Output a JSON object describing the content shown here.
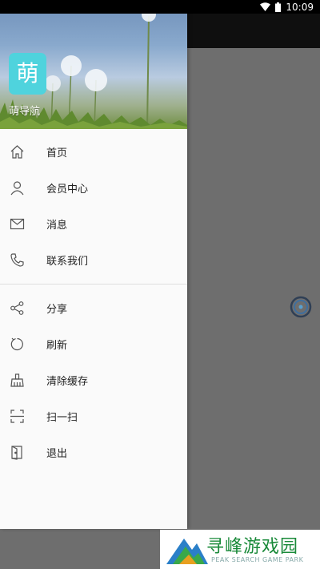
{
  "status_bar": {
    "time": "10:09"
  },
  "drawer": {
    "header": {
      "logo_char": "萌",
      "app_name": "萌导航"
    },
    "section1": [
      {
        "label": "首页",
        "icon": "home-icon"
      },
      {
        "label": "会员中心",
        "icon": "user-icon"
      },
      {
        "label": "消息",
        "icon": "mail-icon"
      },
      {
        "label": "联系我们",
        "icon": "phone-icon"
      }
    ],
    "section2": [
      {
        "label": "分享",
        "icon": "share-icon"
      },
      {
        "label": "刷新",
        "icon": "refresh-icon"
      },
      {
        "label": "清除缓存",
        "icon": "broom-icon"
      },
      {
        "label": "扫一扫",
        "icon": "scan-icon"
      },
      {
        "label": "退出",
        "icon": "exit-icon"
      }
    ]
  },
  "watermark": {
    "title": "寻峰游戏园",
    "subtitle": "PEAK SEARCH GAME PARK"
  },
  "colors": {
    "accent": "#4fd3dd",
    "drawer_bg": "#fafafa",
    "scrim": "#6e6e6e",
    "watermark_green": "#1a8a3a"
  }
}
